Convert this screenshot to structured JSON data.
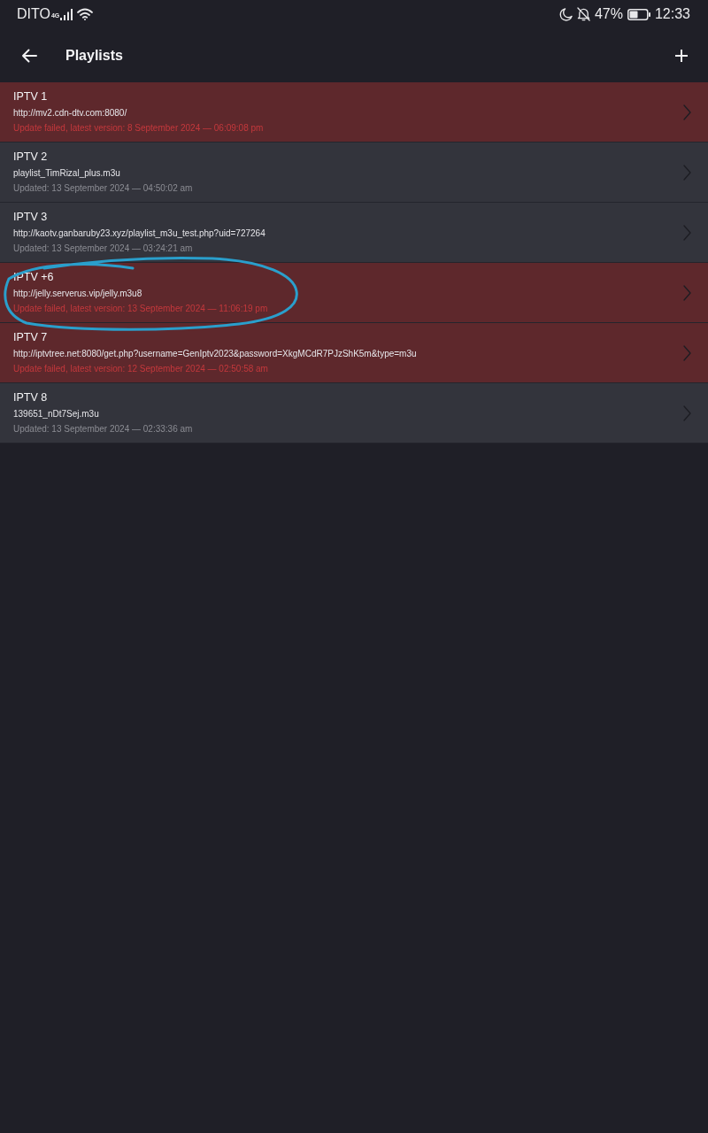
{
  "status_bar": {
    "carrier": "DITO",
    "network": "4G",
    "battery": "47%",
    "time": "12:33"
  },
  "app_bar": {
    "title": "Playlists"
  },
  "playlists": [
    {
      "name": "IPTV 1",
      "url": "http://mv2.cdn-dtv.com:8080/",
      "status": "Update failed, latest version: 8 September 2024 — 06:09:08 pm",
      "failed": true,
      "circled": false
    },
    {
      "name": "IPTV 2",
      "url": "playlist_TimRizal_plus.m3u",
      "status": "Updated: 13 September 2024 — 04:50:02 am",
      "failed": false,
      "circled": false
    },
    {
      "name": "IPTV 3",
      "url": "http://kaotv.ganbaruby23.xyz/playlist_m3u_test.php?uid=727264",
      "status": "Updated: 13 September 2024 — 03:24:21 am",
      "failed": false,
      "circled": false
    },
    {
      "name": "IPTV +6",
      "url": "http://jelly.serverus.vip/jelly.m3u8",
      "status": "Update failed, latest version: 13 September 2024 — 11:06:19 pm",
      "failed": true,
      "circled": true
    },
    {
      "name": "IPTV 7",
      "url": "http://iptvtree.net:8080/get.php?username=GenIptv2023&password=XkgMCdR7PJzShK5m&type=m3u",
      "status": "Update failed, latest version: 12 September 2024 — 02:50:58 am",
      "failed": true,
      "circled": false
    },
    {
      "name": "IPTV 8",
      "url": "139651_nDt7Sej.m3u",
      "status": "Updated: 13 September 2024 — 02:33:36 am",
      "failed": false,
      "circled": false
    }
  ]
}
